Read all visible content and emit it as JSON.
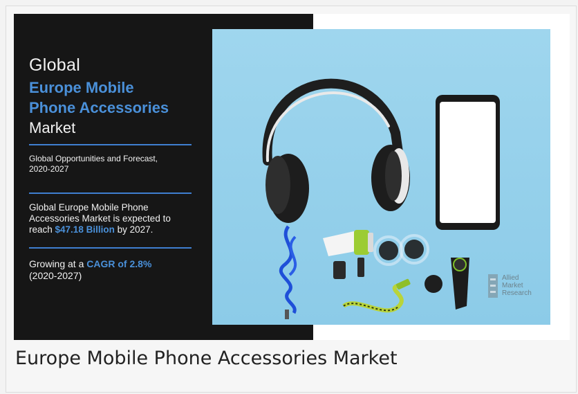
{
  "infographic": {
    "line_global": "Global",
    "market_name_line1": "Europe Mobile",
    "market_name_line2": "Phone Accessories",
    "line_market": "Market",
    "opportunities_line1": "Global Opportunities and Forecast,",
    "opportunities_line2": "2020-2027",
    "forecast_line1": "Global Europe Mobile Phone",
    "forecast_line2": "Accessories Market is expected to",
    "forecast_prefix": "reach ",
    "forecast_value": "$47.18 Billion",
    "forecast_suffix": " by 2027.",
    "cagr_prefix": "Growing at a ",
    "cagr_value": "CAGR of 2.8%",
    "cagr_period": "(2020-2027)",
    "logo_line1": "Allied",
    "logo_line2": "Market",
    "logo_line3": "Research",
    "accent_color": "#4a90d9",
    "panel_color": "#161616",
    "background_color": "#8ccbe8"
  },
  "caption": "Europe Mobile Phone Accessories Market"
}
